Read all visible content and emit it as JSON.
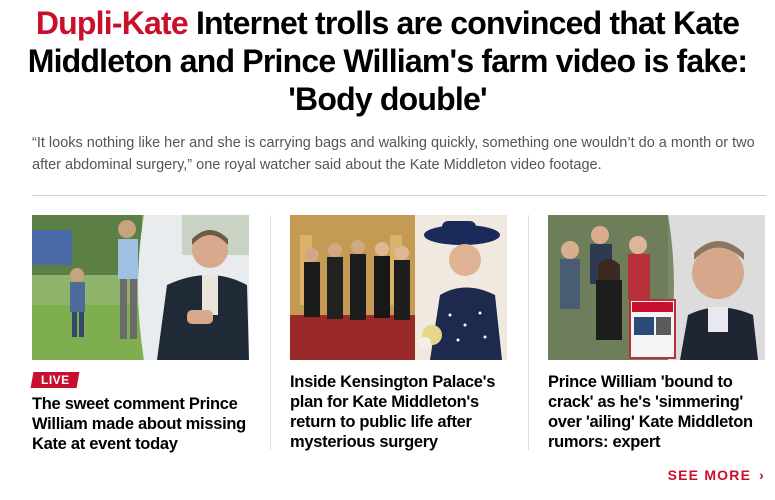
{
  "article": {
    "kicker": "Dupli-Kate",
    "headline": "Internet trolls are convinced that Kate Middleton and Prince William's farm video is fake: 'Body double'",
    "subhead": "“It looks nothing like her and she is carrying bags and walking quickly, something one wouldn’t do a month or two after abdominal surgery,” one royal watcher said about the Kate Middleton video footage."
  },
  "related": [
    {
      "badge": "LIVE",
      "title": "The sweet comment Prince William made about missing Kate at event today"
    },
    {
      "title": "Inside Kensington Palace's plan for Kate Middleton's return to public life after mysterious surgery"
    },
    {
      "title": "Prince William 'bound to crack' as he's 'simmering' over 'ailing' Kate Middleton rumors: expert"
    }
  ],
  "see_more": {
    "label": "SEE MORE",
    "icon": "chevron-right-icon"
  },
  "colors": {
    "accent": "#c8102e",
    "subhead": "#555555",
    "rule": "#cfcfcf"
  }
}
